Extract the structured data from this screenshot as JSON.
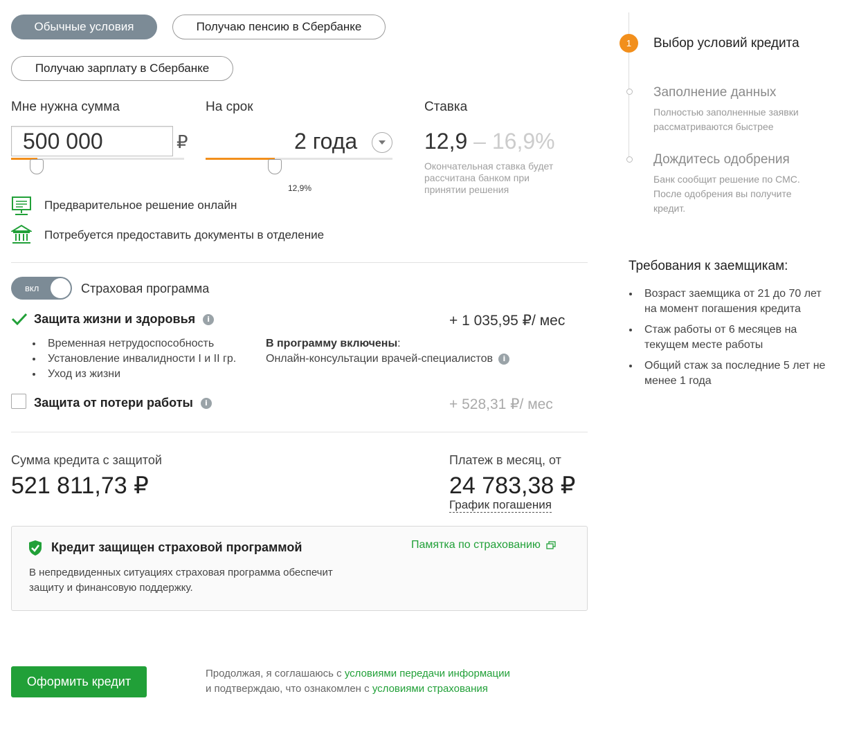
{
  "conditions": {
    "tabs": [
      "Обычные условия",
      "Получаю пенсию в Сбербанке",
      "Получаю зарплату в Сбербанке"
    ],
    "active_tab": "Обычные условия"
  },
  "sum": {
    "label": "Мне нужна сумма",
    "value": "500 000",
    "currency": "₽",
    "slider_fraction": 0.15
  },
  "term": {
    "label": "На срок",
    "value": "2 года",
    "slider_fraction": 0.37,
    "rate_marker": "12,9%"
  },
  "rate": {
    "label": "Ставка",
    "min": "12,9",
    "dash": "–",
    "max": "16,9%",
    "note": "Окончательная ставка будет рассчитана банком при принятии решения"
  },
  "features": [
    {
      "icon": "monitor-icon",
      "text": "Предварительное решение онлайн"
    },
    {
      "icon": "bank-building-icon",
      "text": "Потребуется предоставить документы в отделение"
    }
  ],
  "insurance": {
    "toggle_label": "вкл",
    "title": "Страховая программа",
    "life": {
      "title": "Защита жизни и здоровья",
      "price": "+ 1 035,95 ₽/ мес",
      "items": [
        "Временная нетрудоспособность",
        "Установление инвалидности I и II гр.",
        "Уход из жизни"
      ],
      "included_label": "В программу включены",
      "included_colon": ":",
      "included_value": "Онлайн-консультации врачей-специалистов"
    },
    "job": {
      "title": "Защита от потери работы",
      "price": "+ 528,31 ₽/ мес"
    }
  },
  "summary": {
    "credit_label": "Сумма кредита с защитой",
    "credit_value": "521 811,73 ₽",
    "payment_label": "Платеж в месяц, от",
    "payment_value": "24 783,38 ₽",
    "schedule_link": "График погашения"
  },
  "protected_box": {
    "title": "Кредит защищен страховой программой",
    "link": "Памятка по страхованию",
    "text": "В непредвиденных ситуациях страховая программа обеспечит защиту и финансовую поддержку."
  },
  "footer": {
    "button": "Оформить кредит",
    "line1_prefix": "Продолжая, я соглашаюсь с ",
    "line1_link": "условиями передачи информации",
    "line2_prefix": "и подтверждаю, что ознакомлен с ",
    "line2_link": "условиями страхования"
  },
  "steps": [
    {
      "number": "1",
      "title": "Выбор условий кредита",
      "desc": ""
    },
    {
      "number": "",
      "title": "Заполнение данных",
      "desc": "Полностью заполненные заявки рассматриваются быстрее"
    },
    {
      "number": "",
      "title": "Дождитесь одобрения",
      "desc": "Банк сообщит решение по СМС. После одобрения вы получите кредит."
    }
  ],
  "requirements": {
    "title": "Требования к заемщикам:",
    "items": [
      "Возраст заемщика от 21 до 70 лет на момент погашения кредита",
      "Стаж работы от 6 месяцев на текущем месте работы",
      "Общий стаж за последние 5 лет не менее 1 года"
    ]
  },
  "colors": {
    "green": "#21a038",
    "orange": "#f28f1c",
    "grey_active": "#7c8b96"
  }
}
